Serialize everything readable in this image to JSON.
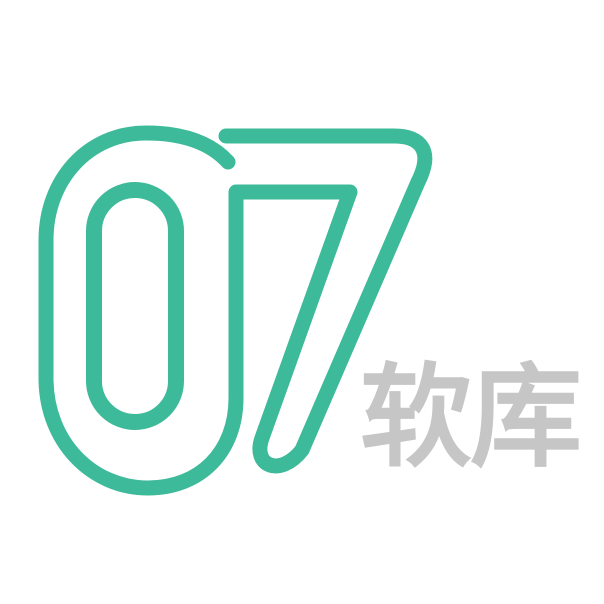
{
  "logo": {
    "mark_text": "07",
    "wordmark": "软库",
    "colors": {
      "mark": "#3dba99",
      "wordmark": "#c6c6c6",
      "background": "#ffffff"
    }
  }
}
